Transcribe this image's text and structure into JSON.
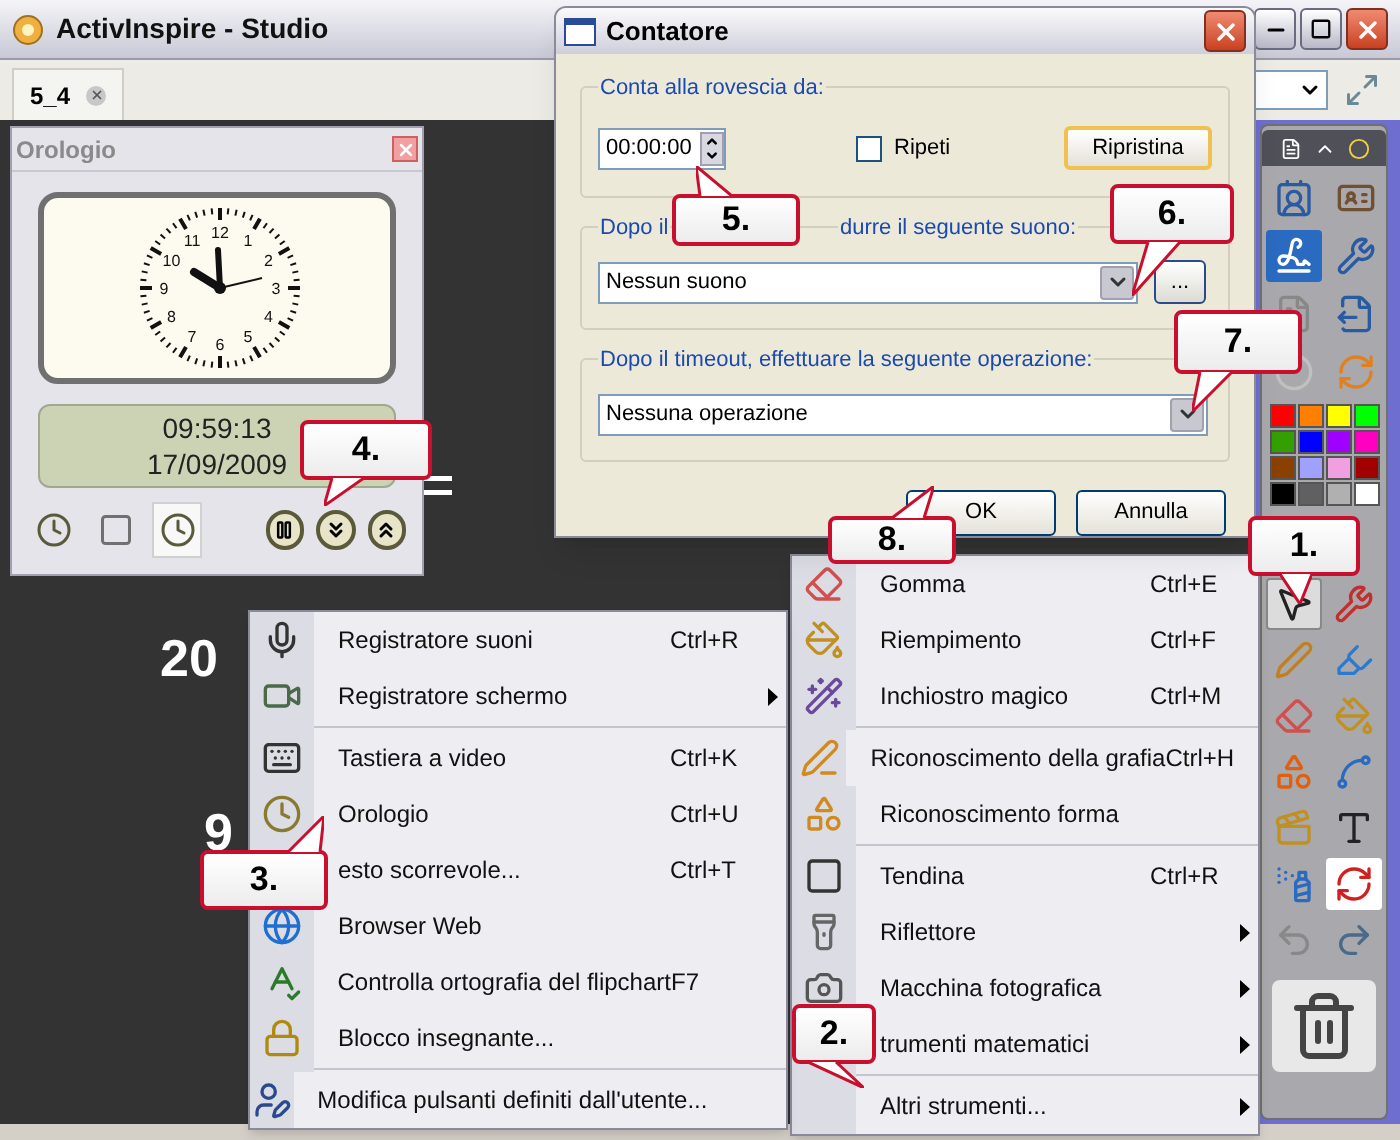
{
  "window": {
    "title": "ActivInspire - Studio"
  },
  "tabs": [
    {
      "label": "5_4"
    }
  ],
  "canvas_numbers": [
    "20",
    "9"
  ],
  "clock": {
    "title": "Orologio",
    "dial_numbers": [
      "12",
      "11",
      "1",
      "10",
      "2",
      "9",
      "3",
      "8",
      "4",
      "7",
      "5",
      "6"
    ],
    "time": "09:59:13",
    "date": "17/09/2009",
    "modes": [
      {
        "kind": "analog",
        "selected": false
      },
      {
        "kind": "digital",
        "selected": false
      },
      {
        "kind": "both",
        "selected": true
      }
    ]
  },
  "dialog": {
    "title": "Contatore",
    "countdown": {
      "legend": "Conta alla rovescia da:",
      "value": "00:00:00",
      "repeat": {
        "label": "Ripeti",
        "checked": false
      },
      "reset_button": "Ripristina"
    },
    "sound": {
      "legend_parts": [
        "Dopo il",
        "durre il seguente suono:"
      ],
      "value": "Nessun suono",
      "browse_button": "..."
    },
    "action": {
      "legend": "Dopo il timeout, effettuare la seguente operazione:",
      "value": "Nessuna operazione"
    },
    "buttons": [
      "OK",
      "Annulla"
    ]
  },
  "menu_left": [
    {
      "label": "Registratore suoni",
      "shortcut": "Ctrl+R",
      "submenu": false,
      "separator_before": false
    },
    {
      "label": "Registratore schermo",
      "submenu": true,
      "separator_before": false
    },
    {
      "label": "Tastiera a video",
      "shortcut": "Ctrl+K",
      "submenu": false,
      "separator_before": true
    },
    {
      "label": "Orologio",
      "shortcut": "Ctrl+U",
      "submenu": false,
      "separator_before": false
    },
    {
      "label": "esto scorrevole...",
      "shortcut": "Ctrl+T",
      "submenu": false,
      "separator_before": false
    },
    {
      "label": "Browser Web",
      "submenu": false,
      "separator_before": false
    },
    {
      "label": "Controlla ortografia del flipchart",
      "shortcut": "F7",
      "submenu": false,
      "separator_before": false
    },
    {
      "label": "Blocco insegnante...",
      "submenu": false,
      "separator_before": false
    },
    {
      "label": "Modifica pulsanti definiti dall'utente...",
      "submenu": false,
      "separator_before": true
    }
  ],
  "menu_right": [
    {
      "label": "Gomma",
      "shortcut": "Ctrl+E",
      "submenu": false,
      "separator_before": false
    },
    {
      "label": "Riempimento",
      "shortcut": "Ctrl+F",
      "submenu": false,
      "separator_before": false
    },
    {
      "label": "Inchiostro magico",
      "shortcut": "Ctrl+M",
      "submenu": false,
      "separator_before": false
    },
    {
      "label": "Riconoscimento della grafia",
      "shortcut": "Ctrl+H",
      "submenu": false,
      "separator_before": true
    },
    {
      "label": "Riconoscimento forma",
      "submenu": false,
      "separator_before": false
    },
    {
      "label": "Tendina",
      "shortcut": "Ctrl+R",
      "submenu": false,
      "separator_before": true
    },
    {
      "label": "Riflettore",
      "submenu": true,
      "separator_before": false
    },
    {
      "label": "Macchina fotografica",
      "submenu": true,
      "separator_before": false
    },
    {
      "label": "trumenti matematici",
      "submenu": true,
      "separator_before": false
    },
    {
      "label": "Altri strumenti...",
      "submenu": true,
      "separator_before": true
    }
  ],
  "palette": [
    {
      "color": "#ff0000"
    },
    {
      "color": "#ff8000"
    },
    {
      "color": "#ffff00"
    },
    {
      "color": "#00ff00"
    },
    {
      "color": "#33a000"
    },
    {
      "color": "#0000ff"
    },
    {
      "color": "#a000ff"
    },
    {
      "color": "#ff00c0"
    },
    {
      "color": "#8b4000"
    },
    {
      "color": "#a0a0ff"
    },
    {
      "color": "#f0a0e0"
    },
    {
      "color": "#a00000"
    },
    {
      "color": "#000000"
    },
    {
      "color": "#606060"
    },
    {
      "color": "#b0b0b0"
    },
    {
      "color": "#ffffff"
    }
  ],
  "callouts": [
    "1.",
    "2.",
    "3.",
    "4.",
    "5.",
    "6.",
    "7.",
    "8."
  ]
}
